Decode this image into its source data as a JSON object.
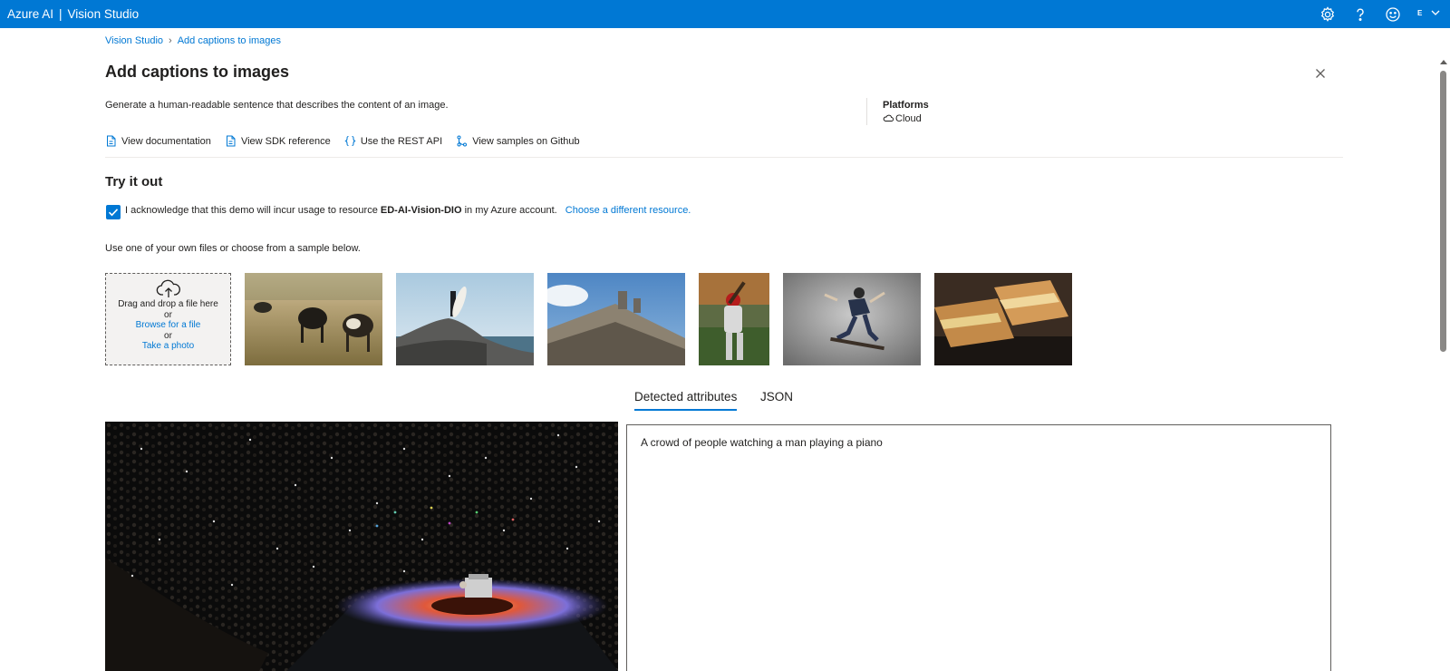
{
  "topbar": {
    "product": "Azure AI",
    "separator": "|",
    "app": "Vision Studio",
    "avatar_initial": "E"
  },
  "breadcrumb": {
    "items": [
      "Vision Studio",
      "Add captions to images"
    ]
  },
  "page": {
    "title": "Add captions to images",
    "description": "Generate a human-readable sentence that describes the content of an image."
  },
  "platforms": {
    "label": "Platforms",
    "value": "Cloud"
  },
  "links": [
    {
      "label": "View documentation",
      "icon": "document-icon"
    },
    {
      "label": "View SDK reference",
      "icon": "document-icon"
    },
    {
      "label": "Use the REST API",
      "icon": "code-braces-icon"
    },
    {
      "label": "View samples on Github",
      "icon": "branch-icon"
    }
  ],
  "try_it": {
    "title": "Try it out",
    "ack_prefix": "I acknowledge that this demo will incur usage to resource",
    "ack_resource": "ED-AI-Vision-DIO",
    "ack_suffix": "in my Azure account.",
    "ack_checked": true,
    "change_resource_link": "Choose a different resource.",
    "use_files_text": "Use one of your own files or choose from a sample below."
  },
  "dropzone": {
    "drag_text": "Drag and drop a file here",
    "or1": "or",
    "browse": "Browse for a file",
    "or2": "or",
    "take_photo": "Take a photo"
  },
  "samples": [
    "cows-grazing",
    "surfer-on-rock",
    "building-statue",
    "baseball-batter",
    "skateboarder",
    "sandwich"
  ],
  "tabs": {
    "items": [
      "Detected attributes",
      "JSON"
    ],
    "active": "Detected attributes"
  },
  "result": {
    "caption": "A crowd of people watching a man playing a piano"
  },
  "colors": {
    "accent": "#0078d4",
    "text": "#201f1e"
  }
}
